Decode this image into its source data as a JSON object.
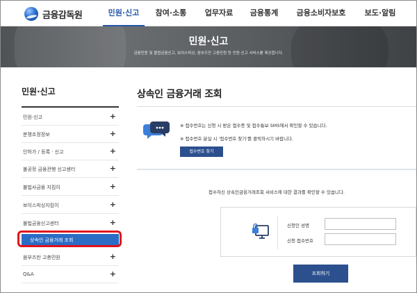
{
  "header": {
    "logo_text": "금융감독원",
    "nav": [
      "민원·신고",
      "참여·소통",
      "업무자료",
      "금융통계",
      "금융소비자보호",
      "보도·알림"
    ],
    "active_index": 0
  },
  "banner": {
    "title": "민원·신고",
    "subtitle": "금융민원 및 불법금융신고, 보이스피싱, 음부즈만 고충민원 등 민원·신고 서비스를 제공합니다."
  },
  "sidebar": {
    "title": "민원·신고",
    "items": [
      {
        "label": "민원·신고",
        "icon": "plus-icon"
      },
      {
        "label": "분쟁조정정보",
        "icon": "plus-icon"
      },
      {
        "label": "인허가 / 등록 · 신고",
        "icon": "plus-icon"
      },
      {
        "label": "불공정 금융관행 신고센터",
        "icon": "plus-icon"
      },
      {
        "label": "불법사금융 지킴이",
        "icon": "plus-icon"
      },
      {
        "label": "보이스피싱지킴이",
        "icon": "plus-icon"
      },
      {
        "label": "불법금융신고센터",
        "icon": "plus-icon"
      },
      {
        "label": "옴부즈만 고충민원",
        "icon": "plus-icon"
      },
      {
        "label": "Q&A",
        "icon": "plus-icon"
      }
    ],
    "active_sub": "상속인 금융거래 조회",
    "highlight_color": "#e0121b"
  },
  "main": {
    "title": "상속인 금융거래 조회",
    "notices": [
      "※ 접수번호는 신청 시 받은 접수증 및 접수통보 SMS에서 확인할 수 있습니다.",
      "※ 접수번호 분실 시 '접수번호 찾기'를 클릭하시기 바랍니다."
    ],
    "find_button": "접수번호 찾기",
    "info": "접수하신 상속인금융거래조회 서비스에 대한 결과를 확인할 수 있습니다.",
    "form": {
      "name_label": "신청인 성명",
      "name_value": "",
      "receipt_label": "신청 접수번호",
      "receipt_value": ""
    },
    "submit_button": "조회하기"
  },
  "colors": {
    "brand": "#2356a8",
    "button": "#2c4f8e",
    "active_sub_bg": "#2b6cc4"
  }
}
